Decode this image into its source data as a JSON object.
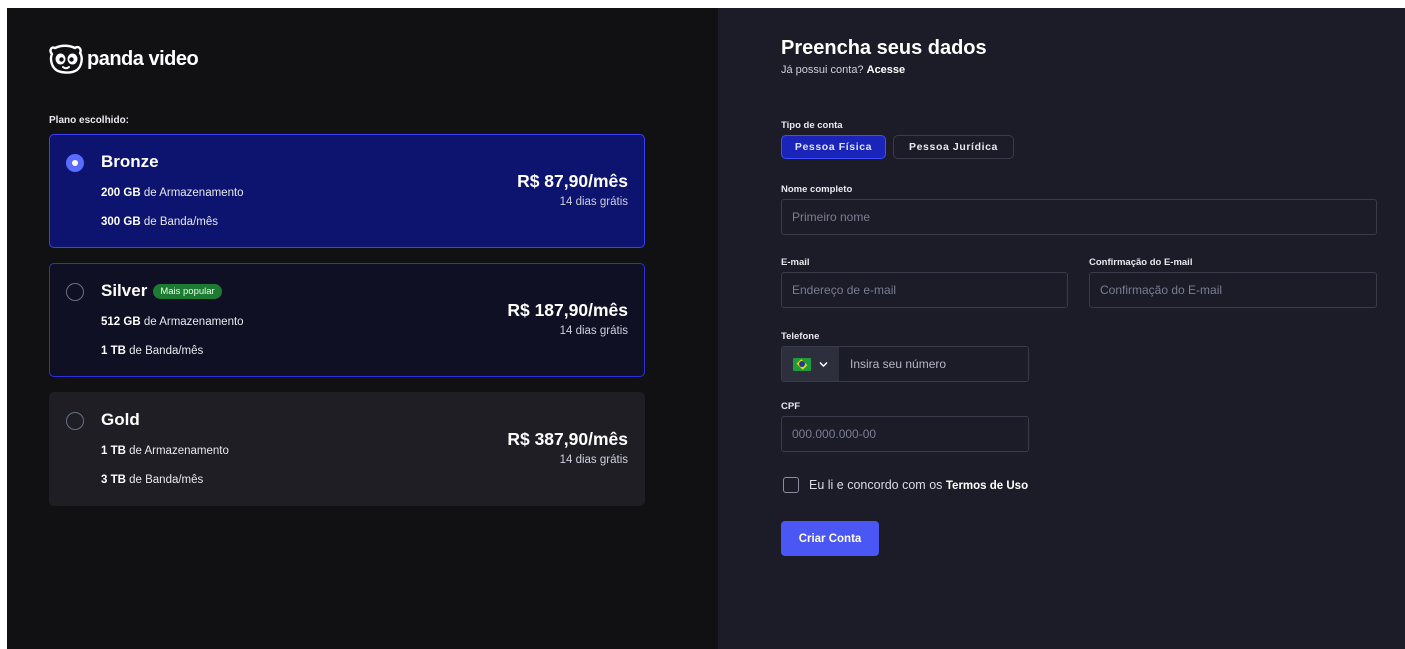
{
  "brand": {
    "name": "panda video",
    "logo_icon": "panda-face-icon"
  },
  "plans": {
    "label": "Plano escolhido:",
    "items": [
      {
        "name": "Bronze",
        "badge": "",
        "storage_value": "200 GB",
        "storage_text": " de Armazenamento",
        "bandwidth_value": "300 GB",
        "bandwidth_text": " de Banda/mês",
        "price": "R$ 87,90/mês",
        "trial": "14 dias grátis",
        "selected": true
      },
      {
        "name": "Silver",
        "badge": "Mais popular",
        "storage_value": "512 GB",
        "storage_text": " de Armazenamento",
        "bandwidth_value": "1 TB",
        "bandwidth_text": " de Banda/mês",
        "price": "R$ 187,90/mês",
        "trial": "14 dias grátis",
        "selected": false
      },
      {
        "name": "Gold",
        "badge": "",
        "storage_value": "1 TB",
        "storage_text": " de Armazenamento",
        "bandwidth_value": "3 TB",
        "bandwidth_text": " de Banda/mês",
        "price": "R$ 387,90/mês",
        "trial": "14 dias grátis",
        "selected": false
      }
    ]
  },
  "form": {
    "title": "Preencha seus dados",
    "subtitle_text": "Já possui conta? ",
    "subtitle_link": "Acesse",
    "account_type": {
      "label": "Tipo de conta",
      "options": [
        "Pessoa Física",
        "Pessoa Jurídica"
      ],
      "selected": "Pessoa Física"
    },
    "full_name": {
      "label": "Nome completo",
      "placeholder": "Primeiro nome",
      "value": ""
    },
    "email": {
      "label": "E-mail",
      "placeholder": "Endereço de e-mail",
      "value": ""
    },
    "email_confirm": {
      "label": "Confirmação do E-mail",
      "placeholder": "Confirmação do E-mail",
      "value": ""
    },
    "phone": {
      "label": "Telefone",
      "country_flag": "brazil-flag-icon",
      "placeholder": "Insira seu número",
      "value": ""
    },
    "cpf": {
      "label": "CPF",
      "placeholder": "000.000.000-00",
      "value": ""
    },
    "terms": {
      "text": "Eu li e concordo com os ",
      "link": "Termos de Uso",
      "checked": false
    },
    "submit_label": "Criar Conta"
  },
  "colors": {
    "accent": "#4a57f4",
    "selected_plan_bg": "#0d1470",
    "badge_green": "#1c7a33",
    "left_panel_bg": "#111114",
    "right_panel_bg": "#1b1c27"
  }
}
